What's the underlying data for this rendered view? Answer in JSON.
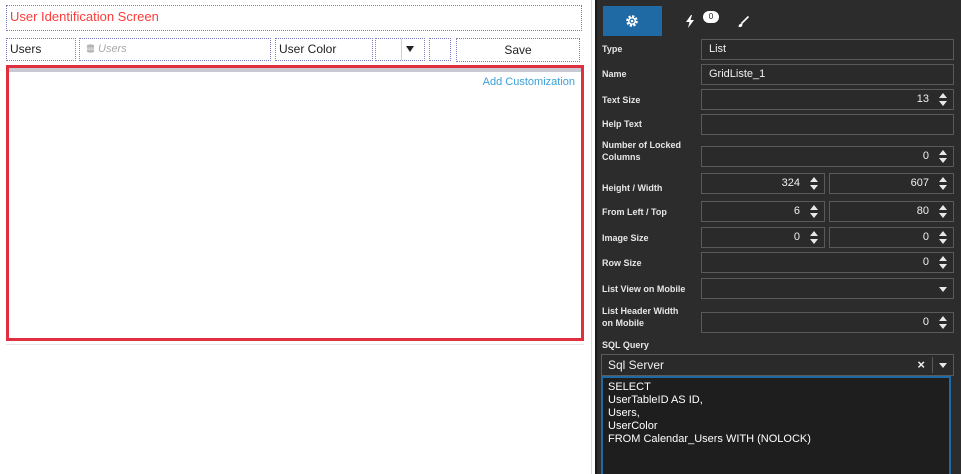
{
  "canvas": {
    "title": "User Identification Screen",
    "users_label": "Users",
    "users_placeholder": "Users",
    "user_color_label": "User Color",
    "save_label": "Save",
    "add_customization": "Add Customization"
  },
  "panel": {
    "tabs": {
      "events_count": "0"
    },
    "properties": {
      "type_label": "Type",
      "type_value": "List",
      "name_label": "Name",
      "name_value": "GridListe_1",
      "text_size_label": "Text Size",
      "text_size_value": "13",
      "help_text_label": "Help Text",
      "help_text_value": "",
      "locked_cols_label_1": "Number of Locked",
      "locked_cols_label_2": "Columns",
      "locked_cols_value": "0",
      "height_width_label": "Height / Width",
      "height_value": "324",
      "width_value": "607",
      "left_top_label": "From Left / Top",
      "left_value": "6",
      "top_value": "80",
      "image_size_label": "Image Size",
      "image_size_value_1": "0",
      "image_size_value_2": "0",
      "row_size_label": "Row Size",
      "row_size_value": "0",
      "list_view_mobile_label": "List View on Mobile",
      "list_view_mobile_value": "",
      "header_width_label_1": "List Header Width",
      "header_width_label_2": "on Mobile",
      "header_width_value": "0",
      "sql_query_label": "SQL Query",
      "sql_engine": "Sql Server",
      "sql_clear": "×",
      "sql_lines": [
        "SELECT",
        "UserTableID AS ID,",
        "Users,",
        "UserColor",
        "FROM Calendar_Users WITH (NOLOCK)"
      ]
    }
  },
  "colors": {
    "accent_blue": "#1f6aa5",
    "selection_red": "#e03040",
    "title_red": "#ff3b3b",
    "link_blue": "#3aa0d8",
    "panel_bg": "#2c2c2c"
  },
  "icons": {
    "settings_tab": "gear-icon",
    "events_tab": "lightning-icon",
    "style_tab": "brush-icon",
    "users_input": "database-icon"
  }
}
